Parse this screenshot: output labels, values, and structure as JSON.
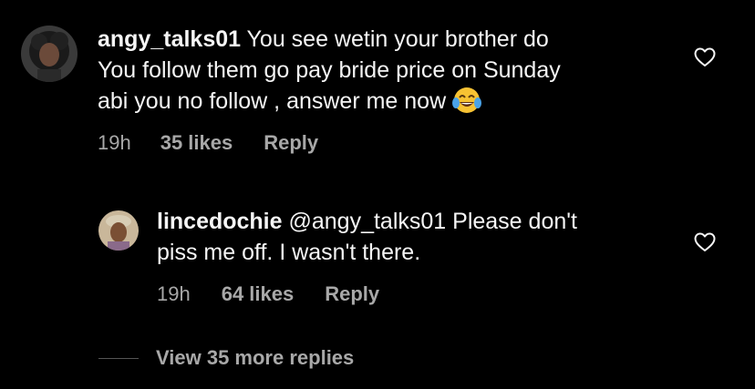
{
  "comments": [
    {
      "username": "angy_talks01",
      "text_line1": " You see wetin your brother do",
      "text_line2": "You follow them go pay bride price on Sunday",
      "text_line3": "abi you no follow , answer me now ",
      "emoji": "face-with-tears-of-joy",
      "time": "19h",
      "likes": "35 likes",
      "reply_label": "Reply"
    },
    {
      "username": "lincedochie",
      "mention": " @angy_talks01",
      "text_line1": " Please don't",
      "text_line2": "piss me off. I wasn't there.",
      "time": "19h",
      "likes": "64 likes",
      "reply_label": "Reply"
    }
  ],
  "view_more_label": "View 35 more replies",
  "icons": {
    "like": "heart-outline-icon"
  },
  "colors": {
    "background": "#000000",
    "primary_text": "#f5f5f5",
    "secondary_text": "#a8a8a8"
  }
}
